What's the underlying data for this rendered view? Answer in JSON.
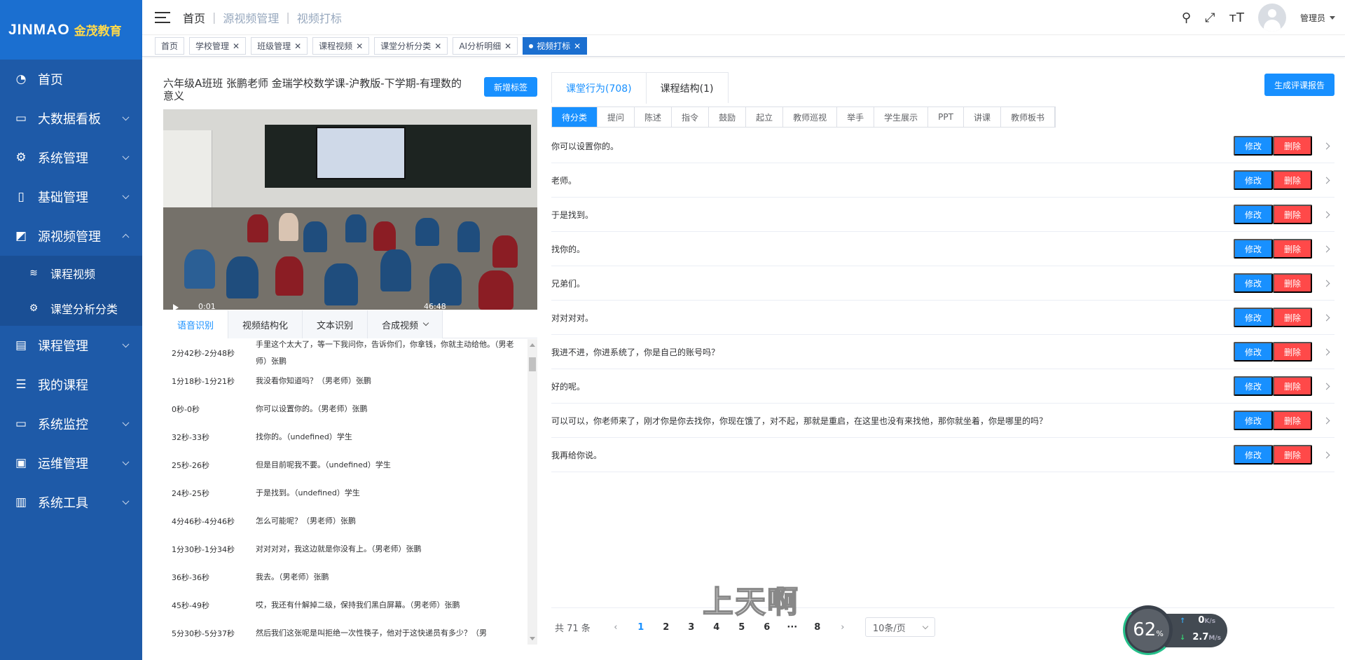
{
  "logo": {
    "en": "JINMAO",
    "cn": "金茂教育"
  },
  "sidebar": {
    "items": [
      {
        "label": "首页",
        "icon": "dashboard-icon"
      },
      {
        "label": "大数据看板",
        "icon": "monitor-icon"
      },
      {
        "label": "系统管理",
        "icon": "gear-icon"
      },
      {
        "label": "基础管理",
        "icon": "book-icon"
      },
      {
        "label": "源视频管理",
        "icon": "chart-icon"
      },
      {
        "label": "课程管理",
        "icon": "course-icon"
      },
      {
        "label": "我的课程",
        "icon": "list-icon"
      },
      {
        "label": "系统监控",
        "icon": "monitor-chart-icon"
      },
      {
        "label": "运维管理",
        "icon": "operation-icon"
      },
      {
        "label": "系统工具",
        "icon": "toolbox-icon"
      }
    ],
    "sub": [
      {
        "label": "课程视频",
        "icon": "database-icon"
      },
      {
        "label": "课堂分析分类",
        "icon": "gear-icon"
      }
    ]
  },
  "header": {
    "breadcrumb": [
      "首页",
      "源视频管理",
      "视频打标"
    ],
    "user": "管理员"
  },
  "tags": [
    {
      "label": "首页",
      "closable": false
    },
    {
      "label": "学校管理",
      "closable": true
    },
    {
      "label": "班级管理",
      "closable": true
    },
    {
      "label": "课程视频",
      "closable": true
    },
    {
      "label": "课堂分析分类",
      "closable": true
    },
    {
      "label": "AI分析明细",
      "closable": true
    },
    {
      "label": "视频打标",
      "closable": true,
      "active": true
    }
  ],
  "video": {
    "title": "六年级A班班 张鹏老师 金瑞学校数学课-沪教版-下学期-有理数的意义",
    "add_tag": "新增标签",
    "current": "0:01",
    "duration": "46:48"
  },
  "left_tabs": [
    "语音识别",
    "视频结构化",
    "文本识别",
    "合成视频"
  ],
  "asr": [
    {
      "time": "2分42秒-2分48秒",
      "text": "手里这个太大了，等一下我问你，告诉你们，你拿钱，你就主动给他。（男老师）张鹏"
    },
    {
      "time": "1分18秒-1分21秒",
      "text": "我没看你知道吗？（男老师）张鹏"
    },
    {
      "time": "0秒-0秒",
      "text": "你可以设置你的。（男老师）张鹏"
    },
    {
      "time": "32秒-33秒",
      "text": "找你的。（undefined）学生"
    },
    {
      "time": "25秒-26秒",
      "text": "但是目前呢我不要。（undefined）学生"
    },
    {
      "time": "24秒-25秒",
      "text": "于是找到。（undefined）学生"
    },
    {
      "time": "4分46秒-4分46秒",
      "text": "怎么可能呢？（男老师）张鹏"
    },
    {
      "time": "1分30秒-1分34秒",
      "text": "对对对对，我这边就是你没有上。（男老师）张鹏"
    },
    {
      "time": "36秒-36秒",
      "text": "我去。（男老师）张鹏"
    },
    {
      "time": "45秒-49秒",
      "text": "哎，我还有什解掉二级，保持我们黑白屏幕。（男老师）张鹏"
    },
    {
      "time": "5分30秒-5分37秒",
      "text": "然后我们这张呢是叫拒绝一次性筷子，他对于这快递员有多少？（男"
    }
  ],
  "right": {
    "tabs": [
      "课堂行为(708)",
      "课程结构(1)"
    ],
    "gen_report": "生成评课报告",
    "categories": [
      "待分类",
      "提问",
      "陈述",
      "指令",
      "鼓励",
      "起立",
      "教师巡视",
      "举手",
      "学生展示",
      "PPT",
      "讲课",
      "教师板书"
    ],
    "edit": "修改",
    "delete": "删除",
    "items": [
      "你可以设置你的。",
      "老师。",
      "于是找到。",
      "找你的。",
      "兄弟们。",
      "对对对对。",
      "我进不进，你进系统了，你是自己的账号吗？",
      "好的呢。",
      "可以可以，你老师来了，刚才你是你去找你，你现在饿了，对不起，那就是重启，在这里也没有来找他，那你就坐着，你是哪里的吗？",
      "我再给你说。"
    ]
  },
  "pager": {
    "total": "共 71 条",
    "pages": [
      "1",
      "2",
      "3",
      "4",
      "5",
      "6",
      "···",
      "8"
    ],
    "current": "1",
    "size": "10条/页"
  },
  "subtitle": "上天啊",
  "speed": {
    "percent": "62",
    "unit": "%",
    "up": "0",
    "up_unit": "K/s",
    "down": "2.7",
    "down_unit": "M/s"
  }
}
